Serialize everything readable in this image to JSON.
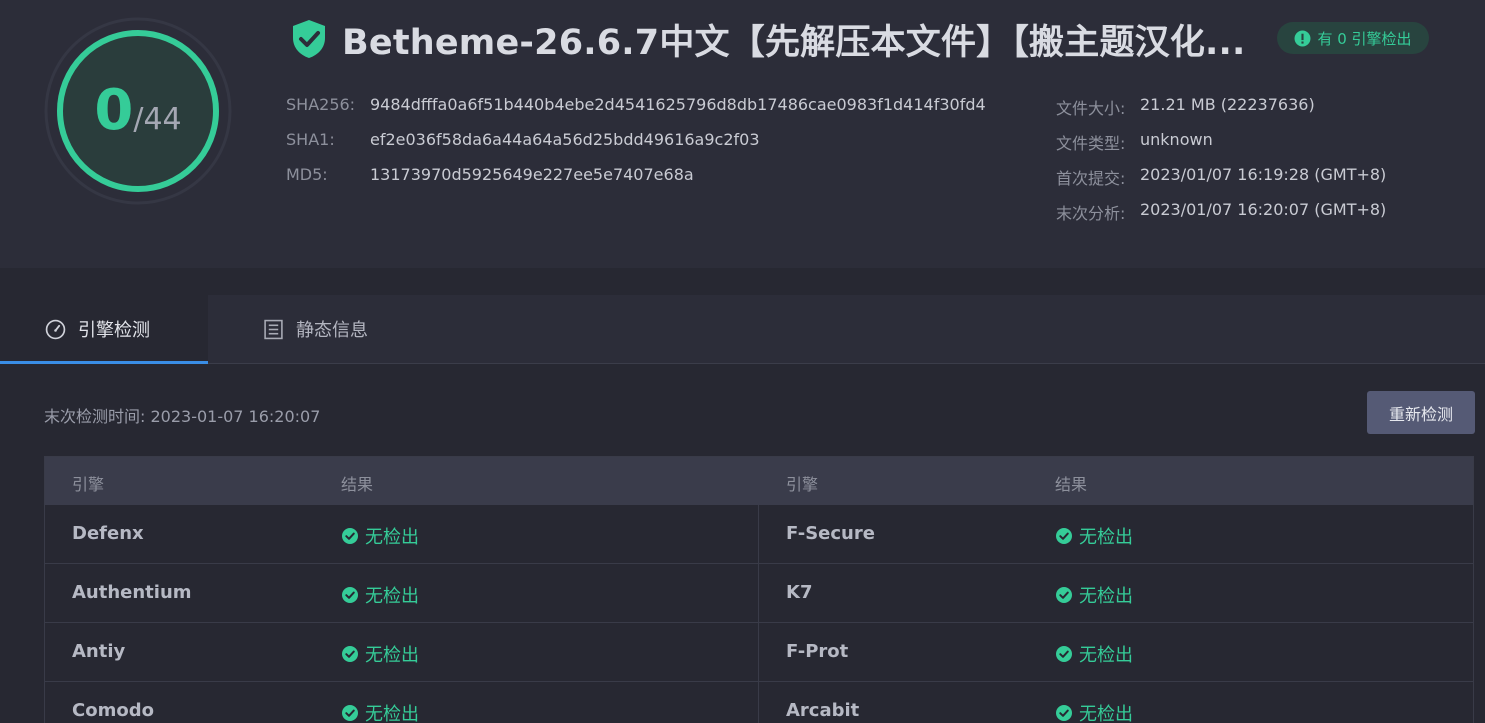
{
  "score": {
    "detected": "0",
    "total": "/44"
  },
  "file": {
    "title": "Betheme-26.6.7中文【先解压本文件】【搬主题汉化...",
    "badge": "有 0 引擎检出",
    "hashes": [
      {
        "label": "SHA256:",
        "value": "9484dfffa0a6f51b440b4ebe2d4541625796d8db17486cae0983f1d414f30fd4"
      },
      {
        "label": "SHA1:",
        "value": "ef2e036f58da6a44a64a56d25bdd49616a9c2f03"
      },
      {
        "label": "MD5:",
        "value": "13173970d5925649e227ee5e7407e68a"
      }
    ],
    "meta": [
      {
        "label": "文件大小:",
        "value": "21.21 MB (22237636)"
      },
      {
        "label": "文件类型:",
        "value": "unknown"
      },
      {
        "label": "首次提交:",
        "value": "2023/01/07 16:19:28 (GMT+8)"
      },
      {
        "label": "末次分析:",
        "value": "2023/01/07 16:20:07 (GMT+8)"
      }
    ]
  },
  "tabs": [
    {
      "label": "引擎检测",
      "icon": "gauge-icon",
      "active": true
    },
    {
      "label": "静态信息",
      "icon": "document-list-icon",
      "active": false
    }
  ],
  "scan": {
    "last_time": "末次检测时间: 2023-01-07 16:20:07",
    "rescan_label": "重新检测"
  },
  "table": {
    "headers": [
      "引擎",
      "结果",
      "引擎",
      "结果"
    ],
    "rows": [
      {
        "left": {
          "engine": "Defenx",
          "result": "无检出"
        },
        "right": {
          "engine": "F-Secure",
          "result": "无检出"
        }
      },
      {
        "left": {
          "engine": "Authentium",
          "result": "无检出"
        },
        "right": {
          "engine": "K7",
          "result": "无检出"
        }
      },
      {
        "left": {
          "engine": "Antiy",
          "result": "无检出"
        },
        "right": {
          "engine": "F-Prot",
          "result": "无检出"
        }
      },
      {
        "left": {
          "engine": "Comodo",
          "result": "无检出"
        },
        "right": {
          "engine": "Arcabit",
          "result": "无检出"
        }
      }
    ]
  },
  "colors": {
    "accent_green": "#35cc98",
    "tab_underline": "#3a8ee6",
    "background": "#272832",
    "header_background": "#2c2d39"
  }
}
